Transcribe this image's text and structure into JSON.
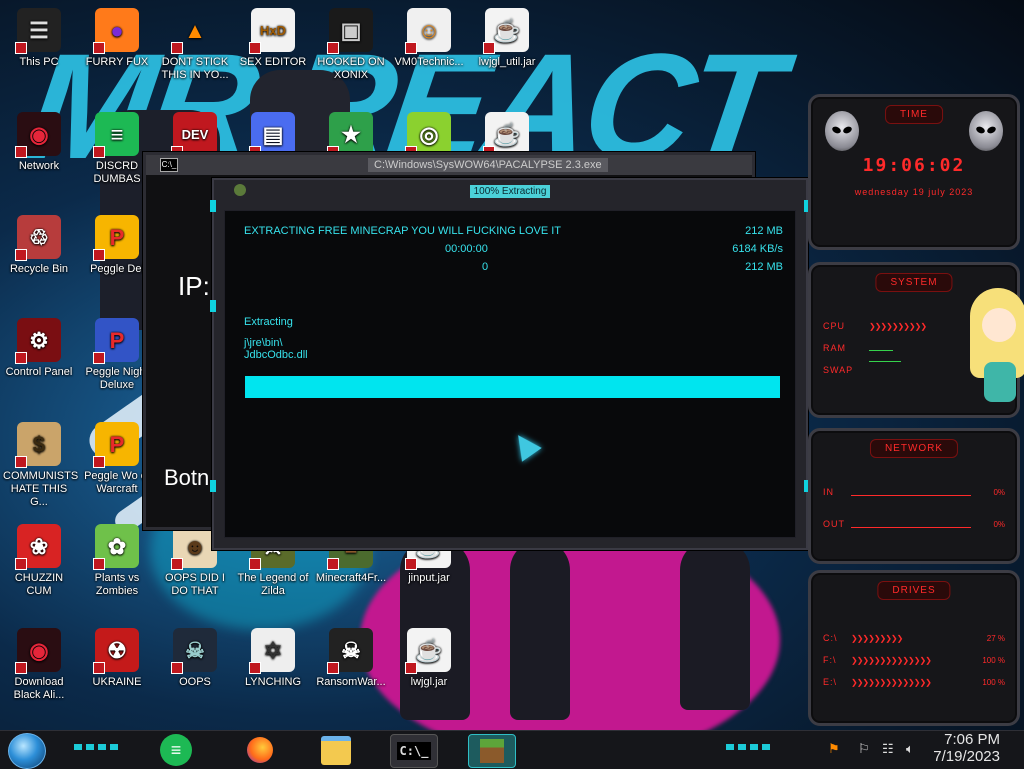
{
  "desktop": {
    "icons": [
      {
        "label": "This PC",
        "glyph": "☰",
        "bg": "#222",
        "fg": "#ddd"
      },
      {
        "label": "FURRY FUX",
        "glyph": "●",
        "bg": "#ff7a1a",
        "fg": "#7b2bd6"
      },
      {
        "label": "DONT STICK THIS IN YO...",
        "glyph": "▲",
        "bg": "transparent",
        "fg": "#ff8a00"
      },
      {
        "label": "SEX EDITOR",
        "glyph": "HxD",
        "bg": "#f2f2f2",
        "fg": "#a05a00"
      },
      {
        "label": "HOOKED ON XONIX",
        "glyph": "▣",
        "bg": "#1a1a1a",
        "fg": "#ccc"
      },
      {
        "label": "VM0Technic...",
        "glyph": "☺",
        "bg": "#f0f0f0",
        "fg": "#e48a1c"
      },
      {
        "label": "lwjgl_util.jar",
        "glyph": "☕",
        "bg": "#f3f3f3",
        "fg": "#d2381f"
      },
      {
        "label": "Network",
        "glyph": "◉",
        "bg": "#2a0d12",
        "fg": "#e5263a"
      },
      {
        "label": "DISCRD DUMBAS",
        "glyph": "≡",
        "bg": "#1db954",
        "fg": "#fff"
      },
      {
        "label": "DEV C++",
        "glyph": "DEV",
        "bg": "#c0181f",
        "fg": "#fff"
      },
      {
        "label": "",
        "glyph": "▤",
        "bg": "#4a6cf0",
        "fg": "#fff"
      },
      {
        "label": "",
        "glyph": "★",
        "bg": "#2ea04a",
        "fg": "#fff"
      },
      {
        "label": "",
        "glyph": "◎",
        "bg": "#8bd12f",
        "fg": "#fff"
      },
      {
        "label": "",
        "glyph": "☕",
        "bg": "#f3f3f3",
        "fg": "#d2381f"
      },
      {
        "label": "Recycle Bin",
        "glyph": "♲",
        "bg": "#b73c3c",
        "fg": "#fff"
      },
      {
        "label": "Peggle Del",
        "glyph": "P",
        "bg": "#f7b500",
        "fg": "#e82a2a"
      },
      {
        "label": "Control Panel",
        "glyph": "⚙",
        "bg": "#7a0e12",
        "fg": "#fff"
      },
      {
        "label": "Peggle Night Deluxe",
        "glyph": "P",
        "bg": "#3254c6",
        "fg": "#e82a2a"
      },
      {
        "label": "COMMUNISTS HATE THIS G...",
        "glyph": "$",
        "bg": "#caa46a",
        "fg": "#3a2a10"
      },
      {
        "label": "Peggle Wo of Warcraft",
        "glyph": "P",
        "bg": "#f7b500",
        "fg": "#e82a2a"
      },
      {
        "label": "CHUZZIN CUM",
        "glyph": "❀",
        "bg": "#d82323",
        "fg": "#fff"
      },
      {
        "label": "Plants vs Zombies",
        "glyph": "✿",
        "bg": "#6fc14a",
        "fg": "#fff"
      },
      {
        "label": "OOPS DID I DO THAT",
        "glyph": "☻",
        "bg": "#e9d7b5",
        "fg": "#5a3a1a"
      },
      {
        "label": "The Legend of Zilda",
        "glyph": "⚔",
        "bg": "#5a6b2a",
        "fg": "#fff"
      },
      {
        "label": "Minecraft4Fr...",
        "glyph": "■",
        "bg": "#4b6b2e",
        "fg": "#8b5a2b"
      },
      {
        "label": "jinput.jar",
        "glyph": "☕",
        "bg": "#f3f3f3",
        "fg": "#d2381f"
      },
      {
        "label": "Download Black Ali...",
        "glyph": "◉",
        "bg": "#2a0d12",
        "fg": "#e5263a"
      },
      {
        "label": "UKRAINE",
        "glyph": "☢",
        "bg": "#c41a1a",
        "fg": "#fff"
      },
      {
        "label": "OOPS",
        "glyph": "☠",
        "bg": "#1f2a3a",
        "fg": "#9cc"
      },
      {
        "label": "LYNCHING",
        "glyph": "✡",
        "bg": "#eee",
        "fg": "#333"
      },
      {
        "label": "RansomWar...",
        "glyph": "☠",
        "bg": "#222",
        "fg": "#fff"
      },
      {
        "label": "lwjgl.jar",
        "glyph": "☕",
        "bg": "#f3f3f3",
        "fg": "#d2381f"
      }
    ]
  },
  "cmd_window": {
    "title": "C:\\Windows\\SysWOW64\\PACALYPSE 2.3.exe",
    "icon_text": "C:\\_",
    "line1": "IP:",
    "line2": "Botn"
  },
  "extract_dialog": {
    "title": "100% Extracting",
    "heading": "EXTRACTING FREE MINECRAP YOU WILL FUCKING LOVE IT",
    "size_total": "212 MB",
    "elapsed": "00:00:00",
    "speed": "6184 KB/s",
    "remaining_count": "0",
    "size_done": "212 MB",
    "status": "Extracting",
    "path": "j\\jre\\bin\\",
    "file": "JdbcOdbc.dll",
    "progress_pct": 100
  },
  "gadgets": {
    "time": {
      "title": "TIME",
      "clock": "19:06:02",
      "date": "wednesday 19 july 2023"
    },
    "system": {
      "title": "SYSTEM",
      "rows": [
        "CPU",
        "RAM",
        "SWAP"
      ]
    },
    "network": {
      "title": "NETWORK",
      "rows": [
        {
          "label": "IN",
          "value": "0%"
        },
        {
          "label": "OUT",
          "value": "0%"
        }
      ]
    },
    "drives": {
      "title": "DRIVES",
      "rows": [
        {
          "label": "C:\\",
          "value": "27 %"
        },
        {
          "label": "F:\\",
          "value": "100 %"
        },
        {
          "label": "E:\\",
          "value": "100 %"
        }
      ]
    }
  },
  "taskbar": {
    "time": "7:06 PM",
    "date": "7/19/2023",
    "cmd_label": "C:\\_"
  },
  "colors": {
    "accent": "#00e5ef",
    "gadget_red": "#ff2a2a",
    "taskbar": "#15161a"
  }
}
